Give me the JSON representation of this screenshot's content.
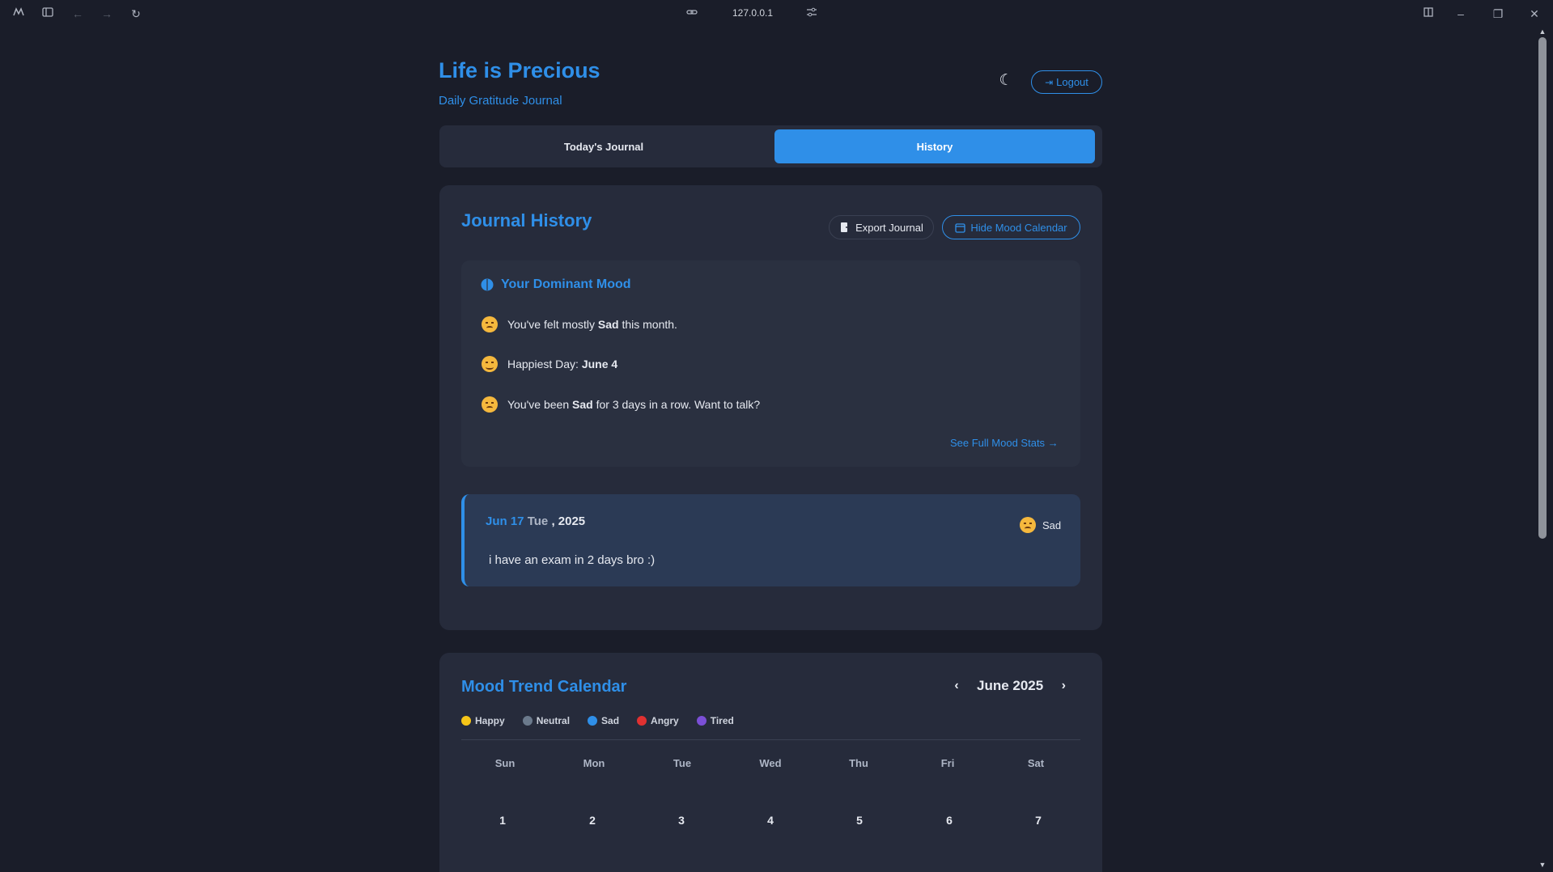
{
  "browser": {
    "url": "127.0.0.1",
    "icons": [
      "app-logo-icon",
      "sidebar-toggle-icon",
      "back-icon",
      "forward-icon",
      "reload-icon",
      "link-icon",
      "settings-sliders-icon",
      "split-view-icon",
      "minimize-icon",
      "restore-icon",
      "close-icon"
    ]
  },
  "header": {
    "title": "Life is Precious",
    "subtitle": "Daily Gratitude Journal",
    "logout_label": "Logout"
  },
  "tabs": [
    {
      "label": "Today's Journal",
      "active": false
    },
    {
      "label": "History",
      "active": true
    }
  ],
  "history": {
    "title": "Journal History",
    "export_label": "Export Journal",
    "hide_calendar_label": "Hide Mood Calendar",
    "dominant": {
      "title": "Your Dominant Mood",
      "line1": {
        "pre": "You've felt mostly ",
        "bold": "Sad",
        "post": " this month."
      },
      "line2": {
        "pre": "Happiest Day: ",
        "bold": "June 4",
        "post": ""
      },
      "line3": {
        "pre": "You've been ",
        "bold": "Sad",
        "post": " for 3 days in a row. Want to talk?"
      },
      "see_stats": "See Full Mood Stats"
    },
    "entry": {
      "date_day": "Jun 17",
      "date_weekday": "Tue",
      "date_year": ", 2025",
      "mood": "Sad",
      "text": "i have an exam in 2 days bro :)"
    }
  },
  "calendar": {
    "title": "Mood Trend Calendar",
    "month": "June 2025",
    "legend": [
      {
        "label": "Happy",
        "color": "#f5c518"
      },
      {
        "label": "Neutral",
        "color": "#6b7a8c"
      },
      {
        "label": "Sad",
        "color": "#2f8fe8"
      },
      {
        "label": "Angry",
        "color": "#e03131"
      },
      {
        "label": "Tired",
        "color": "#7b4fd6"
      }
    ],
    "weekdays": [
      "Sun",
      "Mon",
      "Tue",
      "Wed",
      "Thu",
      "Fri",
      "Sat"
    ],
    "days": [
      "1",
      "2",
      "3",
      "4",
      "5",
      "6",
      "7"
    ]
  },
  "colors": {
    "accent": "#2f8fe8",
    "background": "#1a1d29",
    "card": "#262b3b"
  }
}
